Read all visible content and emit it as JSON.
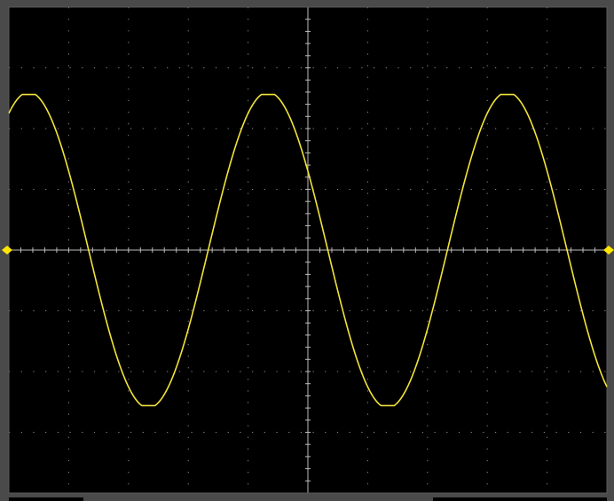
{
  "display": {
    "trace_color": "#f2e33a",
    "background_color": "#000000",
    "grid_color": "#bdbdbd",
    "frame_color": "#5a5a5a",
    "marker_color": "#ffe600"
  },
  "chart_data": {
    "type": "line",
    "title": "",
    "xlabel": "",
    "ylabel": "",
    "xlim": [
      -5,
      5
    ],
    "ylim": [
      -4,
      4
    ],
    "divisions": {
      "x": 10,
      "y": 8
    },
    "grid": true,
    "series": [
      {
        "waveform": "sine",
        "amplitude_div": 2.6,
        "period_div": 4.0,
        "offset_div": 0.0,
        "phase_deg": 150,
        "x": [
          -5.0,
          -4.5,
          -4.0,
          -3.5,
          -3.0,
          -2.5,
          -2.0,
          -1.5,
          -1.0,
          -0.5,
          0.0,
          0.5,
          1.0,
          1.5,
          2.0,
          2.5,
          3.0,
          3.5,
          4.0,
          4.5,
          5.0
        ],
        "y": [
          2.33,
          1.47,
          -0.37,
          -1.98,
          -2.57,
          -1.7,
          0.0,
          1.7,
          2.57,
          1.98,
          0.37,
          -1.47,
          -2.57,
          -1.94,
          0.0,
          1.85,
          2.6,
          1.84,
          -0.0,
          -1.94,
          -2.6
        ]
      }
    ],
    "markers": [
      {
        "name": "ground-level",
        "y": 0
      }
    ]
  }
}
